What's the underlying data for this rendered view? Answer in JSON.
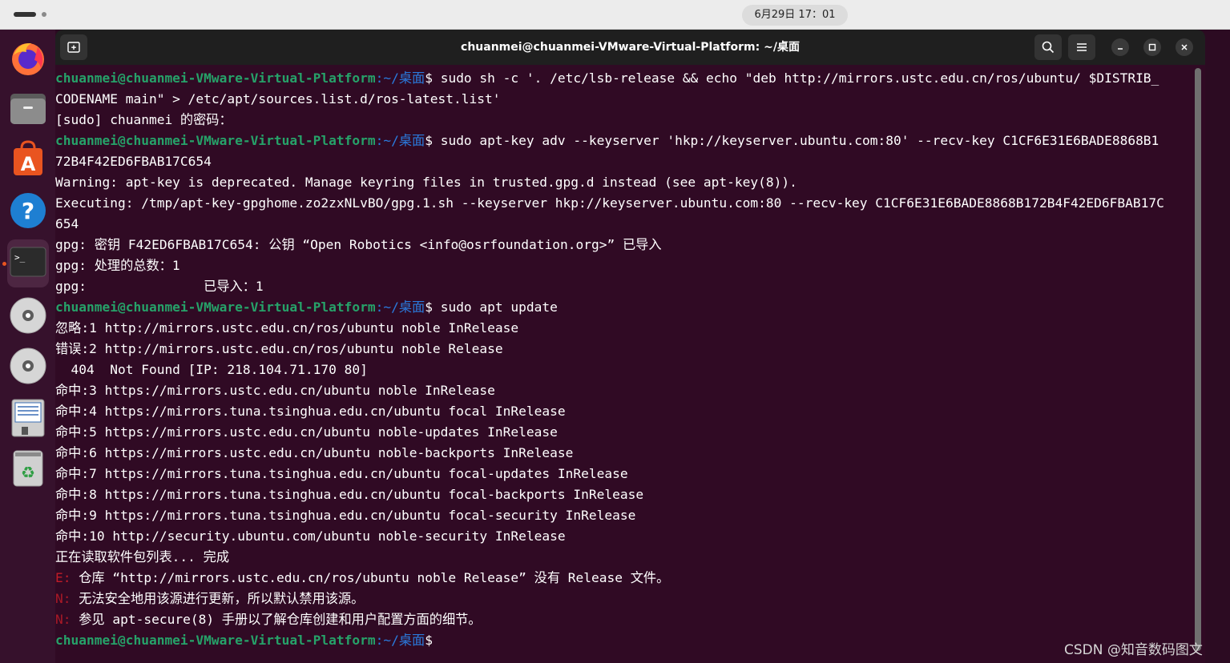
{
  "topbar": {
    "clock": "6月29日 17：01"
  },
  "dock": {
    "items": [
      {
        "name": "firefox",
        "icon": "firefox-icon"
      },
      {
        "name": "files",
        "icon": "folder-icon"
      },
      {
        "name": "app-center",
        "icon": "app-center-icon"
      },
      {
        "name": "help",
        "icon": "help-icon"
      },
      {
        "name": "terminal",
        "icon": "terminal-icon",
        "active": true
      },
      {
        "name": "disc-1",
        "icon": "disc-icon"
      },
      {
        "name": "disc-2",
        "icon": "disc-icon"
      },
      {
        "name": "text-editor",
        "icon": "floppy-icon"
      },
      {
        "name": "trash",
        "icon": "trash-icon"
      }
    ]
  },
  "window": {
    "title": "chuanmei@chuanmei-VMware-Virtual-Platform: ~/桌面"
  },
  "terminal": {
    "prompt_user": "chuanmei@chuanmei-VMware-Virtual-Platform",
    "prompt_path": ":~/桌面",
    "prompt_symbol": "$",
    "lines": [
      {
        "kind": "prompt",
        "text": " sudo sh -c '. /etc/lsb-release && echo \"deb http://mirrors.ustc.edu.cn/ros/ubuntu/ $DISTRIB_"
      },
      {
        "kind": "plain",
        "text": "CODENAME main\" > /etc/apt/sources.list.d/ros-latest.list'"
      },
      {
        "kind": "plain",
        "text": "[sudo] chuanmei 的密码："
      },
      {
        "kind": "prompt",
        "text": " sudo apt-key adv --keyserver 'hkp://keyserver.ubuntu.com:80' --recv-key C1CF6E31E6BADE8868B1"
      },
      {
        "kind": "plain",
        "text": "72B4F42ED6FBAB17C654"
      },
      {
        "kind": "plain",
        "text": "Warning: apt-key is deprecated. Manage keyring files in trusted.gpg.d instead (see apt-key(8))."
      },
      {
        "kind": "plain",
        "text": "Executing: /tmp/apt-key-gpghome.zo2zxNLvBO/gpg.1.sh --keyserver hkp://keyserver.ubuntu.com:80 --recv-key C1CF6E31E6BADE8868B172B4F42ED6FBAB17C"
      },
      {
        "kind": "plain",
        "text": "654"
      },
      {
        "kind": "plain",
        "text": "gpg: 密钥 F42ED6FBAB17C654: 公钥 “Open Robotics <info@osrfoundation.org>” 已导入"
      },
      {
        "kind": "plain",
        "text": "gpg: 处理的总数：1"
      },
      {
        "kind": "plain",
        "text": "gpg:               已导入：1"
      },
      {
        "kind": "prompt",
        "text": " sudo apt update"
      },
      {
        "kind": "plain",
        "text": "忽略:1 http://mirrors.ustc.edu.cn/ros/ubuntu noble InRelease"
      },
      {
        "kind": "plain",
        "text": "错误:2 http://mirrors.ustc.edu.cn/ros/ubuntu noble Release"
      },
      {
        "kind": "plain",
        "text": "  404  Not Found [IP: 218.104.71.170 80]"
      },
      {
        "kind": "plain",
        "text": "命中:3 https://mirrors.ustc.edu.cn/ubuntu noble InRelease"
      },
      {
        "kind": "plain",
        "text": "命中:4 https://mirrors.tuna.tsinghua.edu.cn/ubuntu focal InRelease"
      },
      {
        "kind": "plain",
        "text": "命中:5 https://mirrors.ustc.edu.cn/ubuntu noble-updates InRelease"
      },
      {
        "kind": "plain",
        "text": "命中:6 https://mirrors.ustc.edu.cn/ubuntu noble-backports InRelease"
      },
      {
        "kind": "plain",
        "text": "命中:7 https://mirrors.tuna.tsinghua.edu.cn/ubuntu focal-updates InRelease"
      },
      {
        "kind": "plain",
        "text": "命中:8 https://mirrors.tuna.tsinghua.edu.cn/ubuntu focal-backports InRelease"
      },
      {
        "kind": "plain",
        "text": "命中:9 https://mirrors.tuna.tsinghua.edu.cn/ubuntu focal-security InRelease"
      },
      {
        "kind": "plain",
        "text": "命中:10 http://security.ubuntu.com/ubuntu noble-security InRelease"
      },
      {
        "kind": "plain",
        "text": "正在读取软件包列表... 完成"
      },
      {
        "kind": "error",
        "tag": "E:",
        "text": " 仓库 “http://mirrors.ustc.edu.cn/ros/ubuntu noble Release” 没有 Release 文件。"
      },
      {
        "kind": "notice",
        "tag": "N:",
        "text": " 无法安全地用该源进行更新，所以默认禁用该源。"
      },
      {
        "kind": "notice",
        "tag": "N:",
        "text": " 参见 apt-secure(8) 手册以了解仓库创建和用户配置方面的细节。"
      },
      {
        "kind": "prompt",
        "text": ""
      }
    ]
  },
  "watermark": "CSDN @知音数码图文",
  "colors": {
    "terminal_bg": "#300a24",
    "prompt_user": "#26a269",
    "prompt_path": "#2a7bde",
    "error_tag": "#c01c28"
  }
}
